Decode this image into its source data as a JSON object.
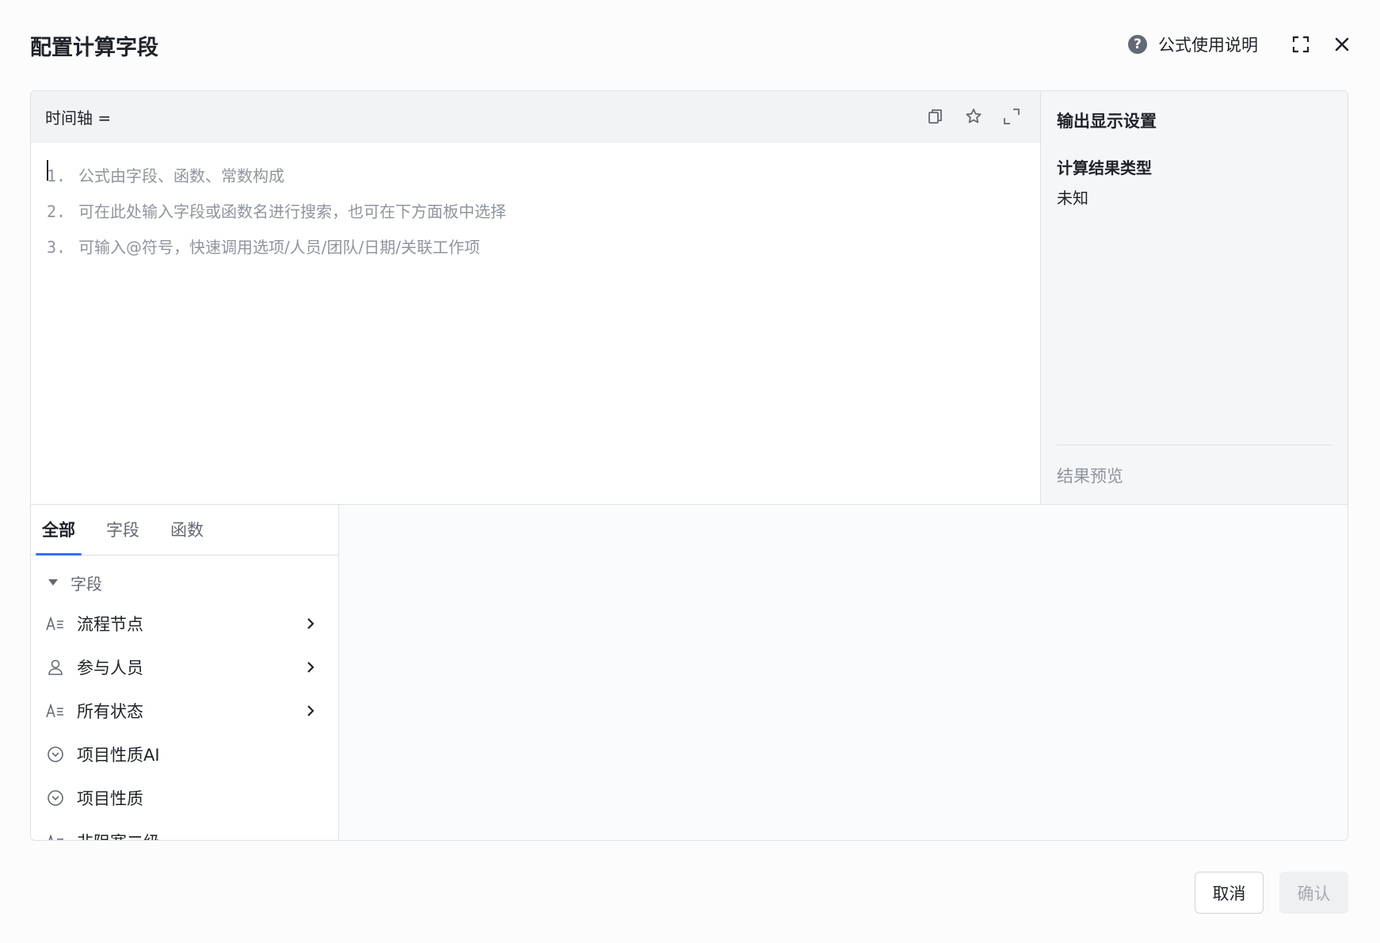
{
  "dialog": {
    "title": "配置计算字段",
    "help_label": "公式使用说明",
    "help_icon": "question-circle-icon"
  },
  "editor": {
    "field_name": "时间轴 =",
    "hints": [
      {
        "num": "1.",
        "text": "公式由字段、函数、常数构成"
      },
      {
        "num": "2.",
        "text": "可在此处输入字段或函数名进行搜索，也可在下方面板中选择"
      },
      {
        "num": "3.",
        "text": "可输入@符号，快速调用选项/人员/团队/日期/关联工作项"
      }
    ]
  },
  "settings": {
    "title": "输出显示设置",
    "result_type_label": "计算结果类型",
    "result_type_value": "未知",
    "preview_label": "结果预览"
  },
  "panel": {
    "tabs": [
      {
        "label": "全部",
        "active": true
      },
      {
        "label": "字段",
        "active": false
      },
      {
        "label": "函数",
        "active": false
      }
    ],
    "section_label": "字段",
    "fields": [
      {
        "label": "流程节点",
        "icon": "text-field-icon",
        "has_children": true
      },
      {
        "label": "参与人员",
        "icon": "person-icon",
        "has_children": true
      },
      {
        "label": "所有状态",
        "icon": "text-field-icon",
        "has_children": true
      },
      {
        "label": "项目性质AI",
        "icon": "select-circle-icon",
        "has_children": false
      },
      {
        "label": "项目性质",
        "icon": "select-circle-icon",
        "has_children": false
      },
      {
        "label": "非阻塞二级",
        "icon": "text-field-icon",
        "has_children": false
      }
    ]
  },
  "footer": {
    "cancel_label": "取消",
    "confirm_label": "确认"
  },
  "colors": {
    "accent": "#3370ff",
    "text_primary": "#1f2329",
    "text_secondary": "#8f959e"
  }
}
